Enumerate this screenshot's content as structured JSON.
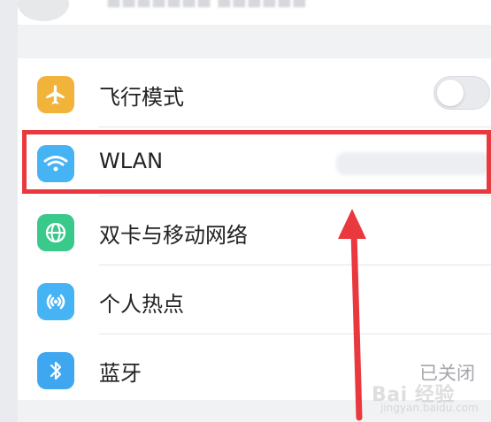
{
  "settings": {
    "items": [
      {
        "label": "飞行模式",
        "icon": "airplane-icon",
        "icon_color": "#f2b33b",
        "toggle_on": false
      },
      {
        "label": "WLAN",
        "icon": "wifi-icon",
        "icon_color": "#46b3f4"
      },
      {
        "label": "双卡与移动网络",
        "icon": "globe-icon",
        "icon_color": "#39c98a"
      },
      {
        "label": "个人热点",
        "icon": "hotspot-icon",
        "icon_color": "#46b3f4"
      },
      {
        "label": "蓝牙",
        "icon": "bluetooth-icon",
        "icon_color": "#3fa7f0",
        "status": "已关闭"
      }
    ]
  },
  "watermark": {
    "text": "Bai 经验",
    "sub": "jingyan.baidu.com"
  },
  "colors": {
    "highlight": "#e9393f",
    "background": "#f1f2f4"
  }
}
